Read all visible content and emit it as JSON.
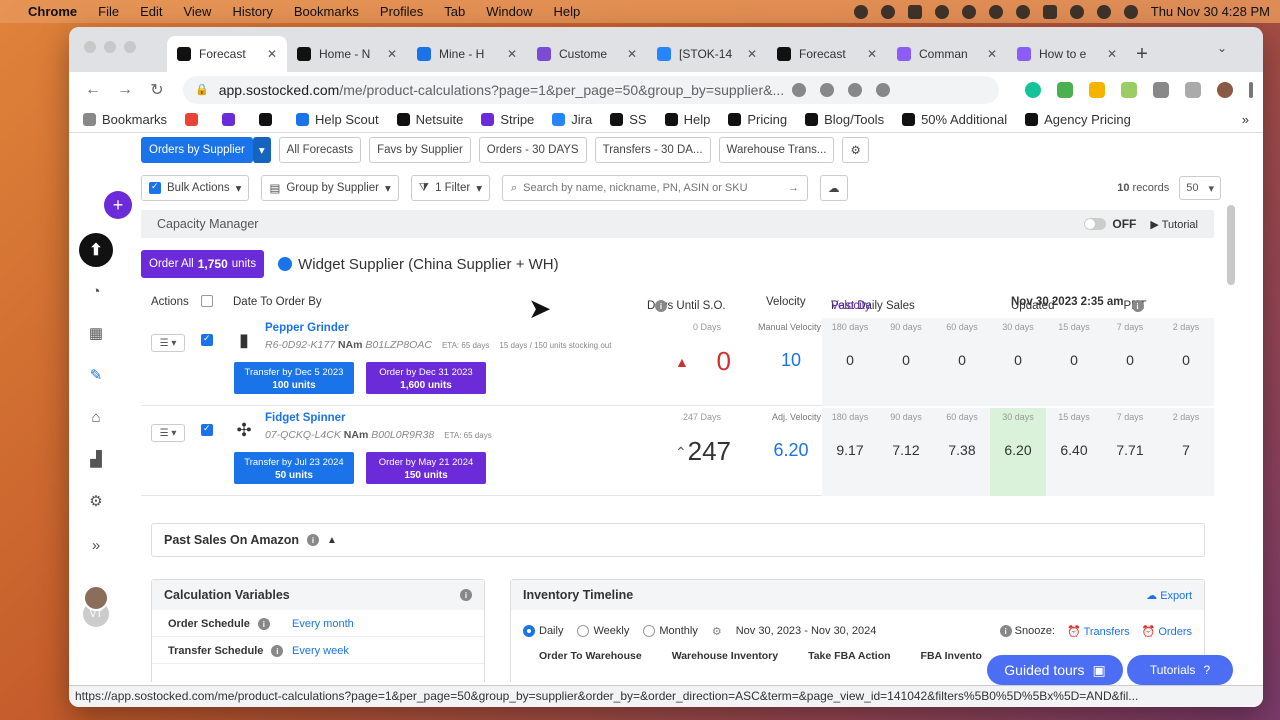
{
  "menubar": {
    "app": "Chrome",
    "items": [
      "File",
      "Edit",
      "View",
      "History",
      "Bookmarks",
      "Profiles",
      "Tab",
      "Window",
      "Help"
    ],
    "clock": "Thu Nov 30  4:28 PM"
  },
  "browser": {
    "tabs": [
      {
        "label": "Forecast",
        "color": "#111111",
        "active": true
      },
      {
        "label": "Home - N",
        "color": "#111111"
      },
      {
        "label": "Mine - H",
        "color": "#1a73e8"
      },
      {
        "label": "Custome",
        "color": "#7b4bd6"
      },
      {
        "label": "[STOK-14",
        "color": "#2684ff"
      },
      {
        "label": "Forecast",
        "color": "#111111"
      },
      {
        "label": "Comman",
        "color": "#8b5cf6"
      },
      {
        "label": "How to e",
        "color": "#8b5cf6"
      }
    ],
    "url_host": "app.sostocked.com",
    "url_path": "/me/product-calculations?page=1&per_page=50&group_by=supplier&...",
    "bookmarks": [
      {
        "label": "Bookmarks",
        "color": "#888888"
      },
      {
        "label": "",
        "color": "#ea4335"
      },
      {
        "label": "",
        "color": "#6c2bd9"
      },
      {
        "label": "",
        "color": "#111111"
      },
      {
        "label": "Help Scout",
        "color": "#1a73e8"
      },
      {
        "label": "Netsuite",
        "color": "#111111"
      },
      {
        "label": "Stripe",
        "color": "#6c2bd9"
      },
      {
        "label": "Jira",
        "color": "#2684ff"
      },
      {
        "label": "SS",
        "color": "#111111"
      },
      {
        "label": "Help",
        "color": "#111111"
      },
      {
        "label": "Pricing",
        "color": "#111111"
      },
      {
        "label": "Blog/Tools",
        "color": "#111111"
      },
      {
        "label": "50% Additional",
        "color": "#111111"
      },
      {
        "label": "Agency Pricing",
        "color": "#111111"
      }
    ],
    "status_url": "https://app.sostocked.com/me/product-calculations?page=1&per_page=50&group_by=supplier&order_by=&order_direction=ASC&term=&page_view_id=141042&filters%5B0%5D%5Bx%5D=AND&fil..."
  },
  "views": {
    "primary": "Orders by Supplier",
    "buttons": [
      "All Forecasts",
      "Favs by Supplier",
      "Orders - 30 DAYS",
      "Transfers - 30 DA...",
      "Warehouse Trans..."
    ]
  },
  "filters": {
    "bulk": "Bulk Actions",
    "group": "Group by Supplier",
    "filter": "1 Filter",
    "search_placeholder": "Search by name, nickname, PN, ASIN or SKU",
    "records_count": "10",
    "records_label": "records",
    "per_page": "50"
  },
  "capacity": {
    "label": "Capacity Manager",
    "toggle": "OFF",
    "tutorial": "Tutorial"
  },
  "supplier": {
    "order_all_prefix": "Order All",
    "order_all_qty": "1,750",
    "order_all_suffix": "units",
    "name": "Widget Supplier (China Supplier + WH)"
  },
  "table": {
    "actions": "Actions",
    "date_to_order": "Date To Order By",
    "days_until": "Days Until S.O.",
    "velocity": "Velocity",
    "past_daily_prefix": "Past Daily Sales",
    "past_daily_suffix": "Velocity",
    "updated_prefix": "Updated",
    "updated_date": "Nov 30 2023 2:35 am",
    "updated_tz": "PDT"
  },
  "products": [
    {
      "name": "Pepper Grinder",
      "sku": "R6-0D92-K177",
      "region": "NAm",
      "asin": "B01LZP8OAC",
      "eta": "ETA: 65 days",
      "eta2": "15 days / 150 units stocking out",
      "chip1_top": "Transfer by Dec 5 2023",
      "chip1_bottom": "100 units",
      "chip2_top": "Order by Dec 31 2023",
      "chip2_bottom": "1,600 units",
      "days_label": "0 Days",
      "days_value": "0",
      "vel_label": "Manual Velocity",
      "vel_value": "10",
      "hist": [
        "0",
        "0",
        "0",
        "0",
        "0",
        "0",
        "0"
      ]
    },
    {
      "name": "Fidget Spinner",
      "sku": "07-QCKQ-L4CK",
      "region": "NAm",
      "asin": "B00L0R9R38",
      "eta": "ETA: 65 days",
      "eta2": "",
      "chip1_top": "Transfer by Jul 23 2024",
      "chip1_bottom": "50 units",
      "chip2_top": "Order by May 21 2024",
      "chip2_bottom": "150 units",
      "days_label": "247 Days",
      "days_value": "247",
      "vel_label": "Adj. Velocity",
      "vel_value": "6.20",
      "hist": [
        "9.17",
        "7.12",
        "7.38",
        "6.20",
        "6.40",
        "7.71",
        "7"
      ]
    }
  ],
  "hist_labels": [
    "180 days",
    "90 days",
    "60 days",
    "30 days",
    "15 days",
    "7 days",
    "2 days"
  ],
  "panels": {
    "past_sales": "Past Sales On Amazon",
    "calc_title": "Calculation Variables",
    "order_schedule_label": "Order Schedule",
    "order_schedule_value": "Every month",
    "transfer_schedule_label": "Transfer Schedule",
    "transfer_schedule_value": "Every week",
    "inv_title": "Inventory Timeline",
    "export": "Export",
    "daily": "Daily",
    "weekly": "Weekly",
    "monthly": "Monthly",
    "date_range": "Nov 30, 2023 - Nov 30, 2024",
    "snooze": "Snooze:",
    "transfers": "Transfers",
    "orders": "Orders",
    "cols": [
      "Order To Warehouse",
      "Warehouse Inventory",
      "Take FBA Action",
      "FBA Invento"
    ]
  },
  "help": {
    "guided": "Guided tours",
    "tutorials": "Tutorials"
  },
  "colors": {
    "accent": "#1a73e8",
    "purple": "#6c2bd9",
    "danger": "#d32f2f"
  }
}
